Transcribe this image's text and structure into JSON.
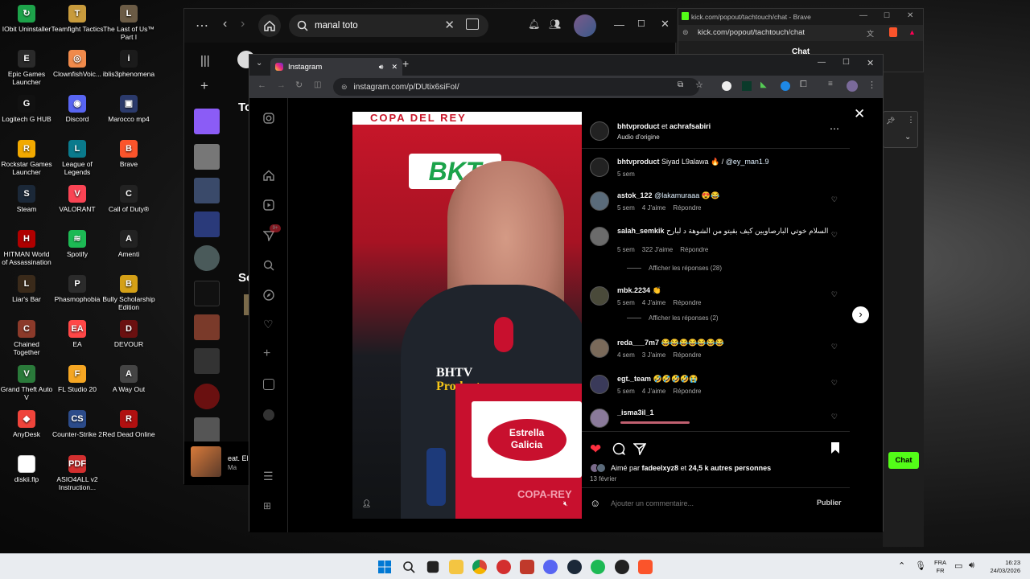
{
  "desktop_icons": [
    {
      "label": "IObit Uninstaller",
      "color": "#1da34a",
      "glyph": "↻"
    },
    {
      "label": "Teamfight Tactics",
      "color": "#c89b3c",
      "glyph": "T"
    },
    {
      "label": "The Last of Us™ Part I",
      "color": "#6b5b45",
      "glyph": "L"
    },
    {
      "label": "Epic Games Launcher",
      "color": "#2a2a2a",
      "glyph": "E"
    },
    {
      "label": "ClownfishVoic...",
      "color": "#f08a4b",
      "glyph": "◎"
    },
    {
      "label": "iblis3phenomena",
      "color": "#1b1b1b",
      "glyph": "i"
    },
    {
      "label": "Logitech G HUB",
      "color": "#111111",
      "glyph": "G"
    },
    {
      "label": "Discord",
      "color": "#5865f2",
      "glyph": "◉"
    },
    {
      "label": "Marocco mp4",
      "color": "#2b3a6b",
      "glyph": "▣"
    },
    {
      "label": "Rockstar Games Launcher",
      "color": "#f2a900",
      "glyph": "R"
    },
    {
      "label": "League of Legends",
      "color": "#0a7a8c",
      "glyph": "L"
    },
    {
      "label": "Brave",
      "color": "#fb542b",
      "glyph": "B"
    },
    {
      "label": "Steam",
      "color": "#1b2838",
      "glyph": "S"
    },
    {
      "label": "VALORANT",
      "color": "#fa4454",
      "glyph": "V"
    },
    {
      "label": "Call of Duty®",
      "color": "#222222",
      "glyph": "C"
    },
    {
      "label": "HITMAN World of Assassination",
      "color": "#b00000",
      "glyph": "H"
    },
    {
      "label": "Spotify",
      "color": "#1db954",
      "glyph": "≋"
    },
    {
      "label": "Amenti",
      "color": "#222222",
      "glyph": "A"
    },
    {
      "label": "Liar's Bar",
      "color": "#3a2a1a",
      "glyph": "L"
    },
    {
      "label": "Phasmophobia",
      "color": "#2b2b2b",
      "glyph": "P"
    },
    {
      "label": "Bully Scholarship Edition",
      "color": "#d4a017",
      "glyph": "B"
    },
    {
      "label": "Chained Together",
      "color": "#8b3a2a",
      "glyph": "C"
    },
    {
      "label": "EA",
      "color": "#ff4747",
      "glyph": "EA"
    },
    {
      "label": "DEVOUR",
      "color": "#6a1010",
      "glyph": "D"
    },
    {
      "label": "Grand Theft Auto V",
      "color": "#2a7a3a",
      "glyph": "V"
    },
    {
      "label": "FL Studio 20",
      "color": "#f5a623",
      "glyph": "F"
    },
    {
      "label": "A Way Out",
      "color": "#444444",
      "glyph": "A"
    },
    {
      "label": "AnyDesk",
      "color": "#ef443b",
      "glyph": "◆"
    },
    {
      "label": "Counter-Strike 2",
      "color": "#2b4b8a",
      "glyph": "CS"
    },
    {
      "label": "Red Dead Online",
      "color": "#b01010",
      "glyph": "R"
    },
    {
      "label": "diskii.flp",
      "color": "#ffffff",
      "glyph": ""
    },
    {
      "label": "ASIO4ALL v2 Instruction...",
      "color": "#d32f2f",
      "glyph": "PDF"
    }
  ],
  "music_app": {
    "search_value": "manal toto",
    "partial_heading_1": "To",
    "partial_heading_2": "So",
    "now_playing_title": "eat. El",
    "now_playing_sub": "Ma"
  },
  "brave_window": {
    "title": "kick.com/popout/tachtouch/chat - Brave",
    "url": "kick.com/popout/tachtouch/chat",
    "heading": "Chat",
    "chat_button": "Chat"
  },
  "browser": {
    "tab_title": "Instagram",
    "url": "instagram.com/p/DUtix6siFoI/"
  },
  "post": {
    "author": "bhtvproduct",
    "coauthor_sep": "et",
    "coauthor": "achrafsabiri",
    "audio": "Audio d'origine",
    "caption_user": "bhtvproduct",
    "caption_text": "Siyad L9alawa 🔥 /",
    "caption_mention": "@ey_man1.9",
    "caption_time": "5 sem",
    "video_watermark_1": "BHTV",
    "video_watermark_2": "Product",
    "video_sponsor_1": "Estrella",
    "video_sponsor_2": "Galicia",
    "video_board_text": "COPA DEL REY",
    "video_corner": "COPA-REY",
    "video_banner": "BKT",
    "comments": [
      {
        "user": "astok_122",
        "mention": "@lakamuraaa",
        "text": "😍😂",
        "time": "5 sem",
        "likes": "4 J'aime",
        "reply": "Répondre",
        "av": "#5a6b7a"
      },
      {
        "user": "salah_semkik",
        "mention": "",
        "text": "السلام خوتي البارصاويين كيف بقيتو من الشوهة د لبارح",
        "time": "5 sem",
        "likes": "322 J'aime",
        "reply": "Répondre",
        "av": "#6b6b6b",
        "replies": "Afficher les réponses (28)"
      },
      {
        "user": "mbk.2234",
        "mention": "",
        "text": "👏",
        "time": "5 sem",
        "likes": "4 J'aime",
        "reply": "Répondre",
        "av": "#4a4a3a",
        "replies": "Afficher les réponses (2)"
      },
      {
        "user": "reda___7m7",
        "mention": "",
        "text": "😂😂😂😂😂😂😂",
        "time": "4 sem",
        "likes": "3 J'aime",
        "reply": "Répondre",
        "av": "#7a6a5a"
      },
      {
        "user": "egt._team",
        "mention": "",
        "text": "🤣🤣🤣🤣😭",
        "time": "5 sem",
        "likes": "4 J'aime",
        "reply": "Répondre",
        "av": "#3a3a5a"
      },
      {
        "user": "_isma3il_1",
        "mention": "",
        "text": "",
        "time": "",
        "likes": "",
        "reply": "",
        "av": "#8a7a9a"
      }
    ],
    "likes_prefix": "Aimé par",
    "likes_user": "fadeelxyz8",
    "likes_suffix": "et",
    "likes_count": "24,5 k autres personnes",
    "date": "13 février",
    "comment_placeholder": "Ajouter un commentaire...",
    "publish": "Publier"
  },
  "taskbar": {
    "lang_1": "FRA",
    "lang_2": "FR",
    "time": "16:23",
    "date": "24/03/2026"
  }
}
